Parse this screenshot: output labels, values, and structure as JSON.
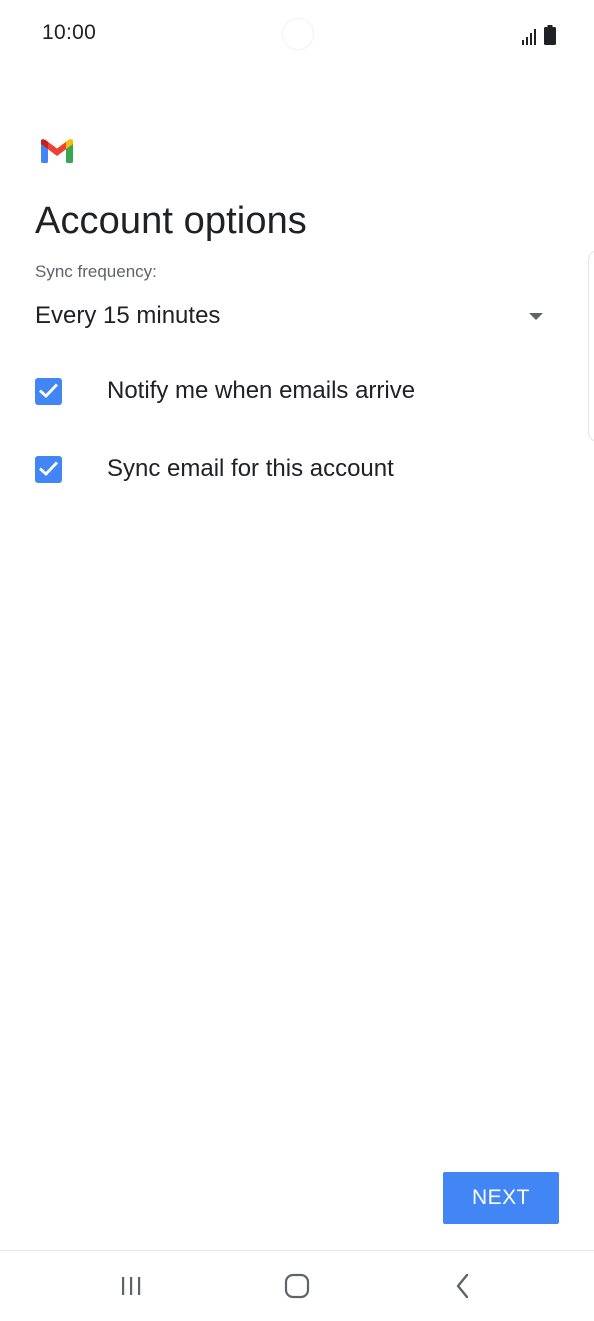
{
  "status_bar": {
    "time": "10:00"
  },
  "app": {
    "logo_icon": "gmail-logo-icon"
  },
  "page": {
    "title": "Account options"
  },
  "sync_frequency": {
    "label": "Sync frequency:",
    "selected": "Every 15 minutes"
  },
  "options": [
    {
      "label": "Notify me when emails arrive",
      "checked": true
    },
    {
      "label": "Sync email for this account",
      "checked": true
    }
  ],
  "actions": {
    "next_label": "NEXT"
  },
  "nav_bar": {
    "icons": [
      "recent-apps-icon",
      "home-icon",
      "back-icon"
    ]
  },
  "colors": {
    "accent": "#4285f4",
    "text_primary": "#202124",
    "text_secondary": "#5f6368"
  }
}
